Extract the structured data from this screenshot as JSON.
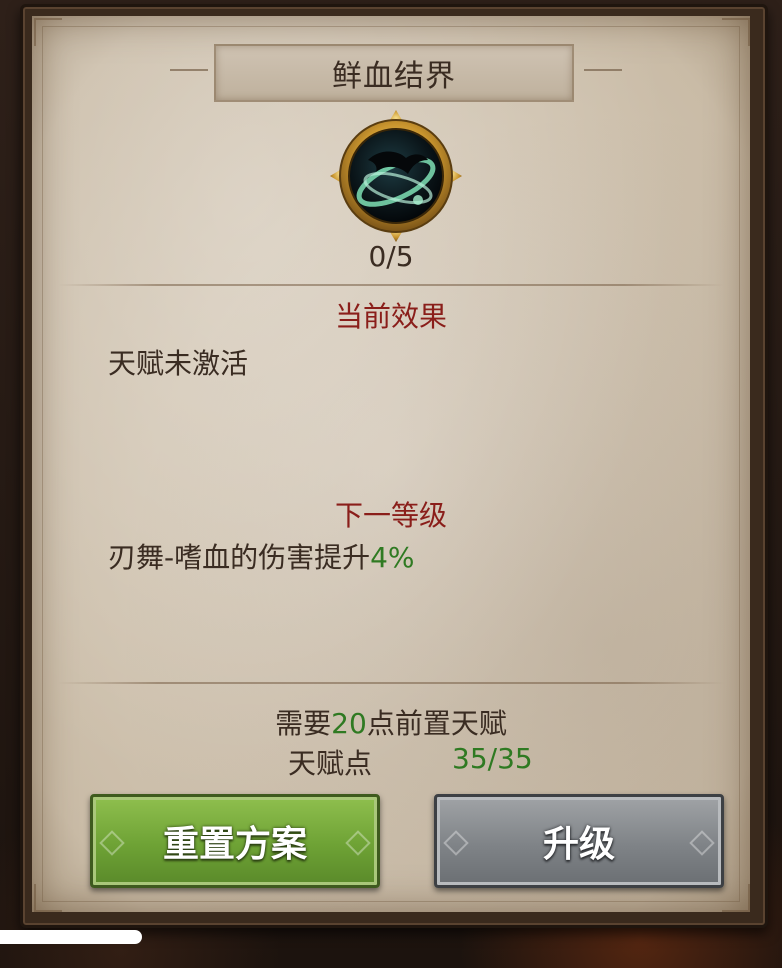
{
  "talent": {
    "name": "鲜血结界",
    "icon": "blood-barrier-talent-icon",
    "level": "0/5"
  },
  "current_effect": {
    "heading": "当前效果",
    "text": "天赋未激活"
  },
  "next_level": {
    "heading": "下一等级",
    "text_prefix": "刃舞-嗜血的伤害提升",
    "value": "4%"
  },
  "requirement": {
    "prefix": "需要",
    "count": "20",
    "suffix": "点前置天赋"
  },
  "talent_points": {
    "label": "天赋点",
    "value": "35/35"
  },
  "buttons": {
    "reset_label": "重置方案",
    "upgrade_label": "升级"
  },
  "colors": {
    "heading_red": "#8a1e1a",
    "value_green": "#2f7a22",
    "reset_button_green": "#6ea235",
    "upgrade_button_gray": "#7f8387",
    "parchment": "#d4c8b7"
  }
}
